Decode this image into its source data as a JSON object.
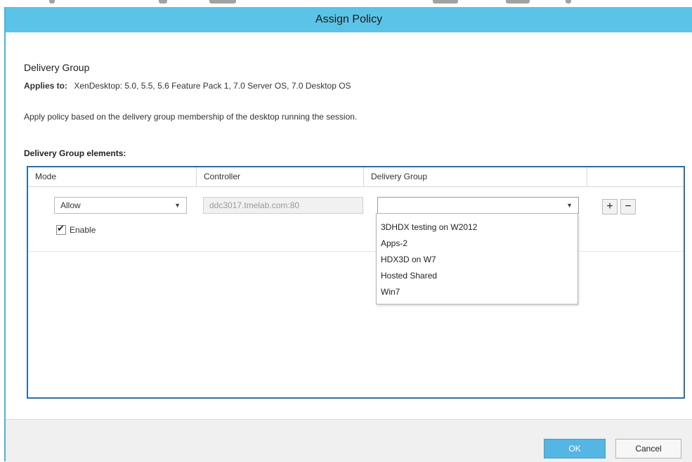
{
  "dialog": {
    "title": "Assign Policy",
    "heading": "Delivery Group",
    "applies_label": "Applies to:",
    "applies_value": "XenDesktop: 5.0, 5.5, 5.6 Feature Pack 1, 7.0 Server OS, 7.0 Desktop OS",
    "description": "Apply policy based on the delivery group membership of the desktop running the session.",
    "elements_label": "Delivery Group elements:"
  },
  "grid": {
    "columns": [
      "Mode",
      "Controller",
      "Delivery Group"
    ],
    "row": {
      "mode_value": "Allow",
      "controller_value": "ddc3017.tmelab.com:80",
      "delivery_group_value": "",
      "enable_label": "Enable",
      "enabled": true,
      "add_label": "+",
      "remove_label": "−"
    }
  },
  "dropdown": {
    "options": [
      "3DHDX testing on W2012",
      "Apps-2",
      "HDX3D on W7",
      "Hosted Shared",
      "Win7"
    ]
  },
  "footer": {
    "ok_label": "OK",
    "cancel_label": "Cancel"
  },
  "icons": {
    "dropdown_arrow": "chevron-down-icon",
    "checkbox_tick": "checkmark-icon"
  },
  "colors": {
    "titlebar": "#5bc3e8",
    "grid_border": "#2d6fa8",
    "ok_button": "#55b6e4"
  }
}
